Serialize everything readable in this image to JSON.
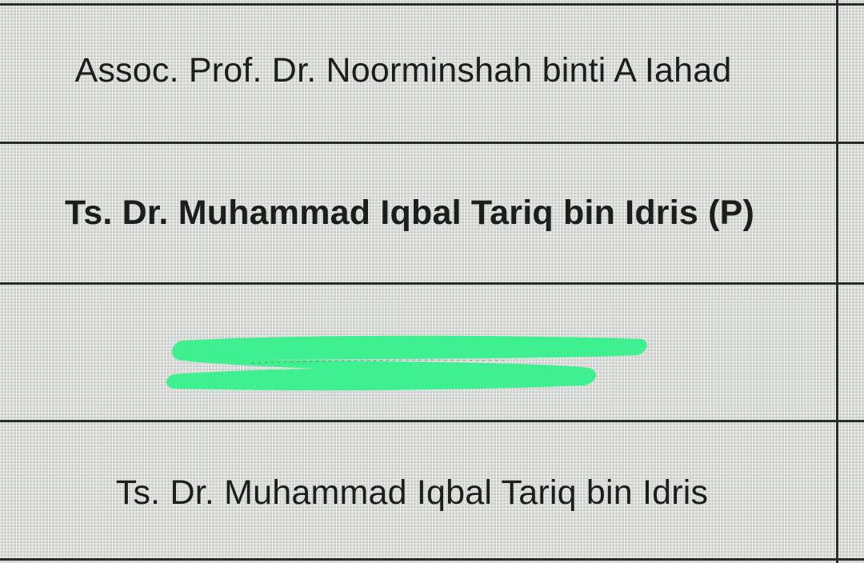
{
  "table": {
    "rows": [
      {
        "text": "Assoc. Prof. Dr. Noorminshah binti A Iahad",
        "bold": false
      },
      {
        "text": "Ts. Dr. Muhammad Iqbal Tariq bin Idris (P)",
        "bold": true
      },
      {
        "text": "",
        "redacted": true
      },
      {
        "text": "Ts. Dr. Muhammad Iqbal Tariq bin Idris",
        "bold": false
      }
    ]
  },
  "colors": {
    "cell_background": "#d3d6d3",
    "grid_line": "#2a2c2b",
    "text": "#1c1e1d",
    "redaction_mark": "#3ef08f"
  }
}
